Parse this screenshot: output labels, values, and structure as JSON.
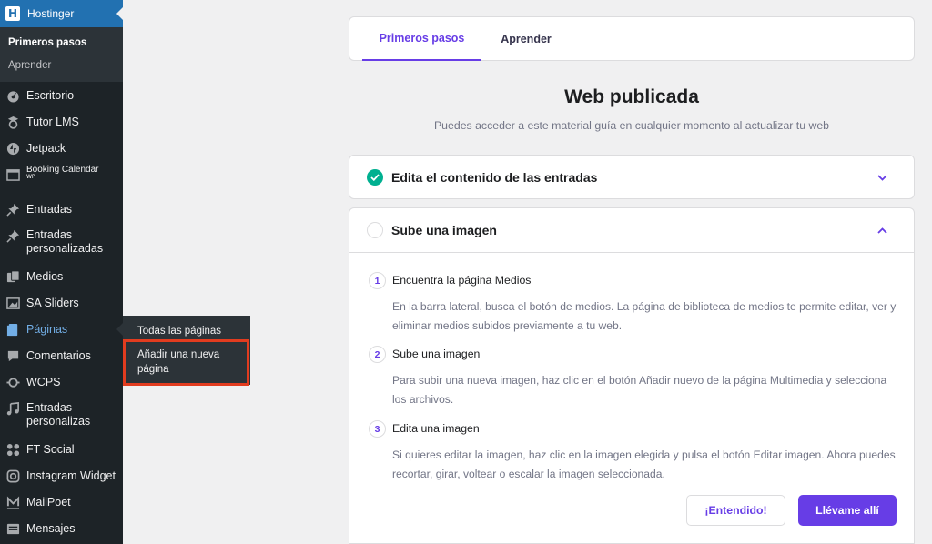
{
  "sidebar": {
    "top_item": "Hostinger",
    "sub_items": [
      "Primeros pasos",
      "Aprender"
    ],
    "items": [
      {
        "label": "Escritorio",
        "icon": "dashboard-icon"
      },
      {
        "label": "Tutor LMS",
        "icon": "graduation-icon"
      },
      {
        "label": "Jetpack",
        "icon": "jetpack-icon"
      },
      {
        "label": "Booking Calendar",
        "sub": "WP",
        "icon": "calendar-icon"
      },
      {
        "label": "Entradas",
        "icon": "pin-icon"
      },
      {
        "label": "Entradas personalizadas",
        "icon": "pin-icon"
      },
      {
        "label": "Medios",
        "icon": "media-icon"
      },
      {
        "label": "SA Sliders",
        "icon": "slider-icon"
      },
      {
        "label": "Páginas",
        "icon": "pages-icon"
      },
      {
        "label": "Comentarios",
        "icon": "comment-icon"
      },
      {
        "label": "WCPS",
        "icon": "wcps-icon"
      },
      {
        "label": "Entradas personalizas",
        "icon": "music-icon"
      },
      {
        "label": "FT Social",
        "icon": "social-icon"
      },
      {
        "label": "Instagram Widget",
        "icon": "instagram-icon"
      },
      {
        "label": "MailPoet",
        "icon": "mailpoet-icon"
      },
      {
        "label": "Mensajes",
        "icon": "messages-icon"
      }
    ]
  },
  "flyout": {
    "items": [
      "Todas las páginas",
      "Añadir una nueva página"
    ]
  },
  "tabs": [
    "Primeros pasos",
    "Aprender"
  ],
  "main": {
    "title": "Web publicada",
    "subtitle": "Puedes acceder a este material guía en cualquier momento al actualizar tu web",
    "card1_title": "Edita el contenido de las entradas",
    "card2_title": "Sube una imagen",
    "steps": [
      {
        "num": "1",
        "title": "Encuentra la página Medios",
        "text": "En la barra lateral, busca el botón de medios. La página de biblioteca de medios te permite editar, ver y eliminar medios subidos previamente a tu web."
      },
      {
        "num": "2",
        "title": "Sube una imagen",
        "text": "Para subir una nueva imagen, haz clic en el botón Añadir nuevo de la página Multimedia y selecciona los archivos."
      },
      {
        "num": "3",
        "title": "Edita una imagen",
        "text": "Si quieres editar la imagen, haz clic en la imagen elegida y pulsa el botón Editar imagen. Ahora puedes recortar, girar, voltear o escalar la imagen seleccionada."
      }
    ],
    "btn_ok": "¡Entendido!",
    "btn_go": "Llévame allí"
  },
  "colors": {
    "accent": "#673de6",
    "sidebar_bg": "#1d2327",
    "wp_blue": "#2271b1",
    "highlight": "#e23c1f",
    "success": "#00b090"
  }
}
